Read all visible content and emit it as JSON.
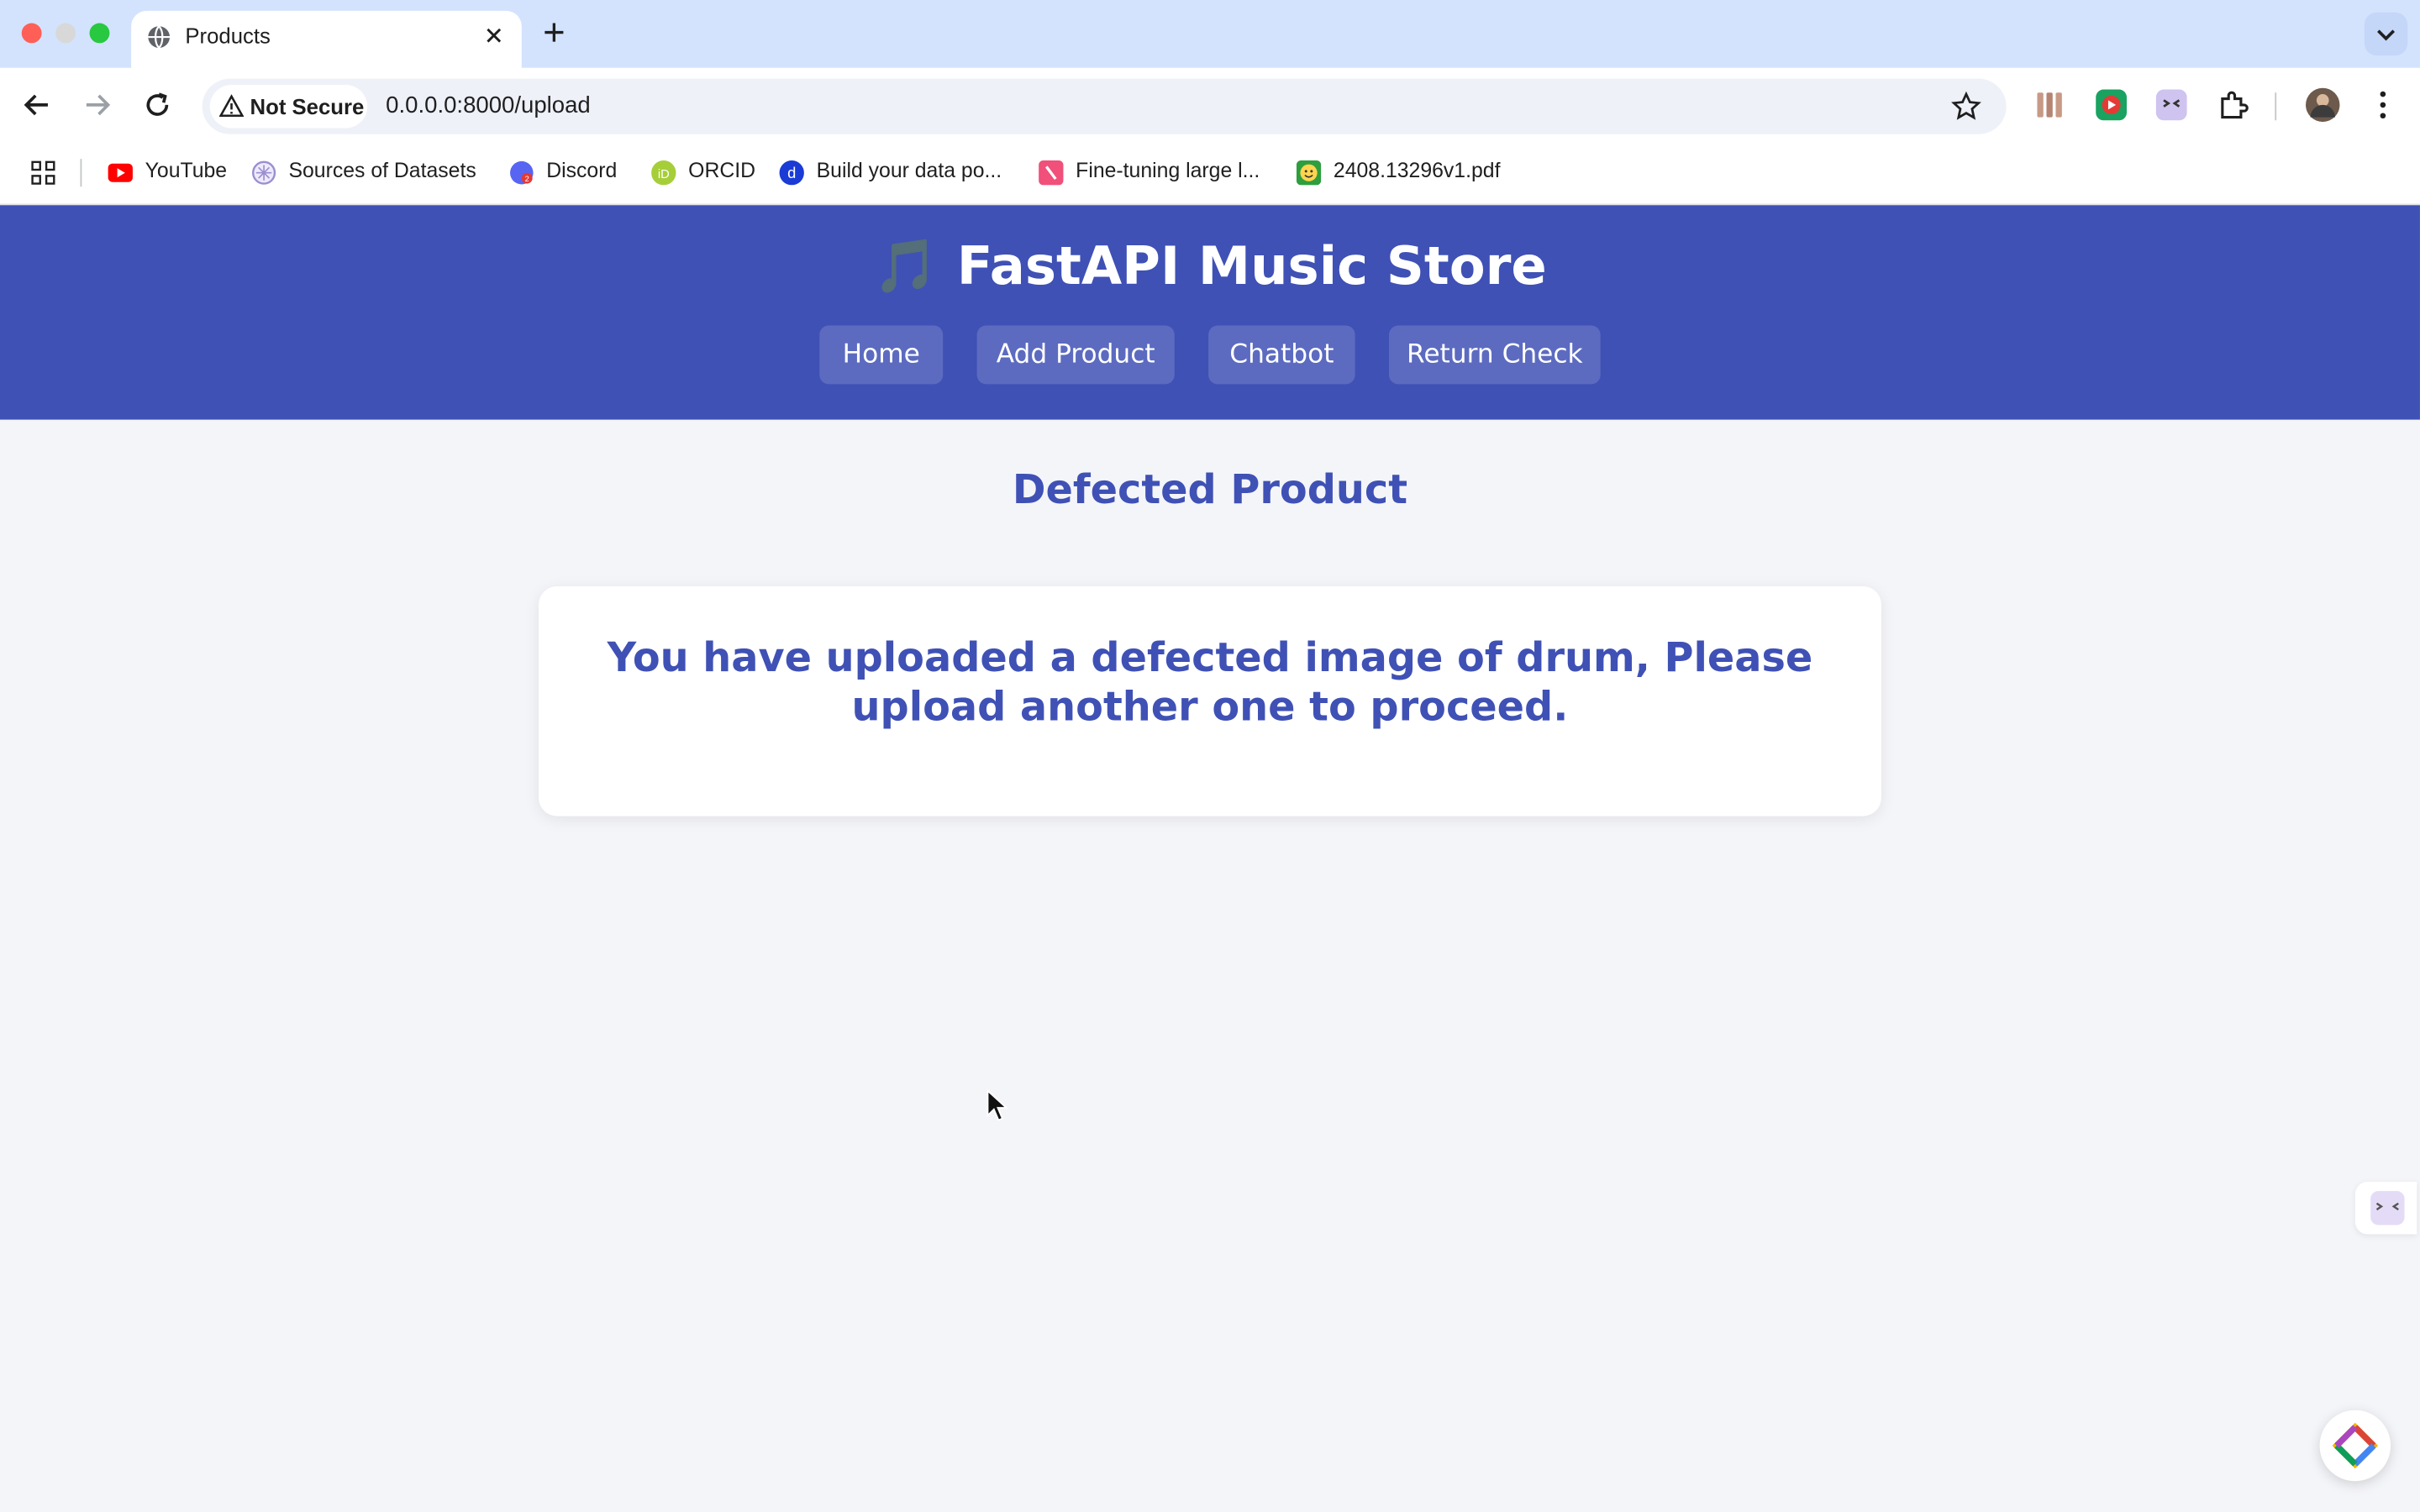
{
  "browser": {
    "tab_title": "Products",
    "security_label": "Not Secure",
    "url": "0.0.0.0:8000/upload",
    "bookmarks": [
      {
        "label": "YouTube",
        "icon": "youtube-icon"
      },
      {
        "label": "Sources of Datasets",
        "icon": "dataset-icon"
      },
      {
        "label": "Discord",
        "icon": "discord-icon"
      },
      {
        "label": "ORCID",
        "icon": "orcid-icon"
      },
      {
        "label": "Build your data po...",
        "icon": "d-icon"
      },
      {
        "label": "Fine-tuning large l...",
        "icon": "slash-icon"
      },
      {
        "label": "2408.13296v1.pdf",
        "icon": "smiley-icon"
      }
    ]
  },
  "site": {
    "title": "🎵 FastAPI Music Store",
    "nav": [
      "Home",
      "Add Product",
      "Chatbot",
      "Return Check"
    ]
  },
  "main": {
    "heading": "Defected Product",
    "message": "You have uploaded a defected image of drum, Please upload another one to proceed."
  },
  "colors": {
    "header_bg": "#3f51b5",
    "nav_button_bg": "#5c6bc0",
    "heading_color": "#3f51b5",
    "page_bg": "#f4f5f9"
  }
}
